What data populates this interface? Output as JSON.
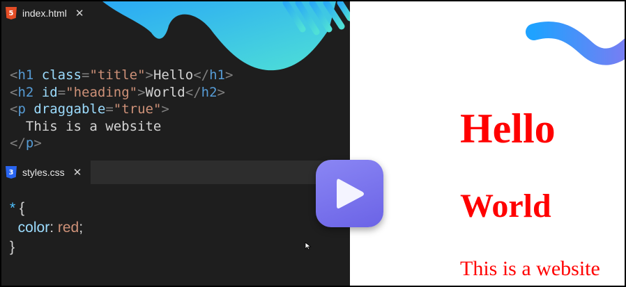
{
  "editor": {
    "html_tab": {
      "filename": "index.html",
      "icon": "html5-file-icon",
      "icon_glyph": "5",
      "close": "✕"
    },
    "html_lines": [
      [
        [
          "br",
          "<"
        ],
        [
          "tg",
          "h1"
        ],
        [
          "tx",
          " "
        ],
        [
          "at",
          "class"
        ],
        [
          "br",
          "="
        ],
        [
          "st",
          "\"title\""
        ],
        [
          "br",
          ">"
        ],
        [
          "tx",
          "Hello"
        ],
        [
          "br",
          "</"
        ],
        [
          "tg",
          "h1"
        ],
        [
          "br",
          ">"
        ]
      ],
      [
        [
          "br",
          "<"
        ],
        [
          "tg",
          "h2"
        ],
        [
          "tx",
          " "
        ],
        [
          "at",
          "id"
        ],
        [
          "br",
          "="
        ],
        [
          "st",
          "\"heading\""
        ],
        [
          "br",
          ">"
        ],
        [
          "tx",
          "World"
        ],
        [
          "br",
          "</"
        ],
        [
          "tg",
          "h2"
        ],
        [
          "br",
          ">"
        ]
      ],
      [
        [
          "br",
          "<"
        ],
        [
          "tg",
          "p"
        ],
        [
          "tx",
          " "
        ],
        [
          "at",
          "draggable"
        ],
        [
          "br",
          "="
        ],
        [
          "st",
          "\"true\""
        ],
        [
          "br",
          ">"
        ]
      ],
      [
        [
          "tx",
          "  This is a website"
        ]
      ],
      [
        [
          "br",
          "</"
        ],
        [
          "tg",
          "p"
        ],
        [
          "br",
          ">"
        ]
      ]
    ],
    "css_tab": {
      "filename": "styles.css",
      "icon": "css3-file-icon",
      "icon_glyph": "3",
      "close": "✕"
    },
    "css_lines": [
      [
        [
          "sel",
          "*"
        ],
        [
          "tx",
          " {"
        ]
      ],
      [
        [
          "tx",
          "  "
        ],
        [
          "prop",
          "color"
        ],
        [
          "tx",
          ": "
        ],
        [
          "val",
          "red"
        ],
        [
          "tx",
          ";"
        ]
      ],
      [
        [
          "tx",
          "}"
        ]
      ]
    ]
  },
  "preview": {
    "h1": "Hello",
    "h2": "World",
    "p": "This is a website"
  },
  "play_button": {
    "icon": "play-icon"
  },
  "colors": {
    "editor_bg": "#1e1e1e",
    "tabbar_bg": "#2d2d2d",
    "preview_text": "#ff0000",
    "play_button": "#7a74ee",
    "decoration_gradient_start": "#1fa2ff",
    "decoration_gradient_end": "#5fe3d0"
  }
}
